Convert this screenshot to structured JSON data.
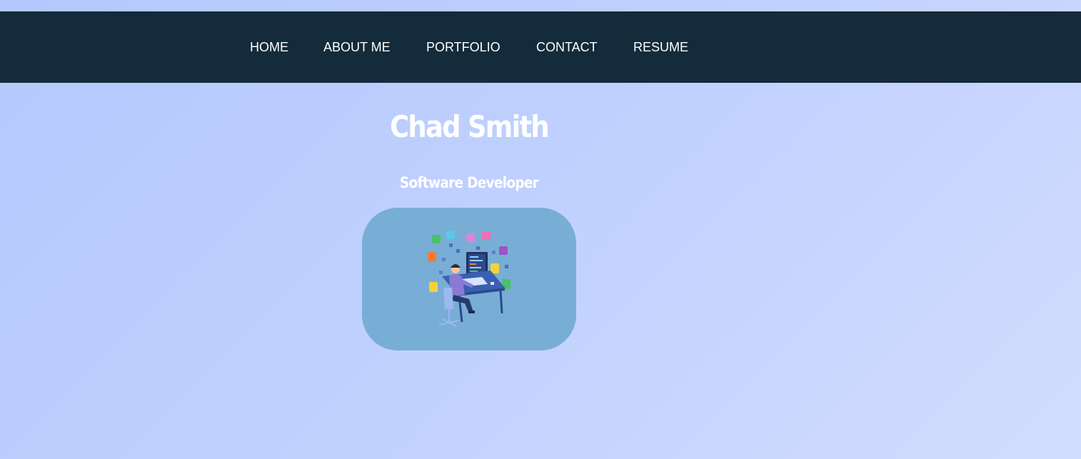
{
  "nav": {
    "items": [
      {
        "label": "HOME"
      },
      {
        "label": "ABOUT ME"
      },
      {
        "label": "PORTFOLIO"
      },
      {
        "label": "CONTACT"
      },
      {
        "label": "RESUME"
      }
    ]
  },
  "hero": {
    "name": "Chad Smith",
    "role": "Software Developer",
    "image_icon": "developer-at-desk-illustration"
  },
  "colors": {
    "nav_background": "#132b3a",
    "page_background": "#b4c8fd",
    "image_card": "#78aed5",
    "text": "#ffffff"
  }
}
